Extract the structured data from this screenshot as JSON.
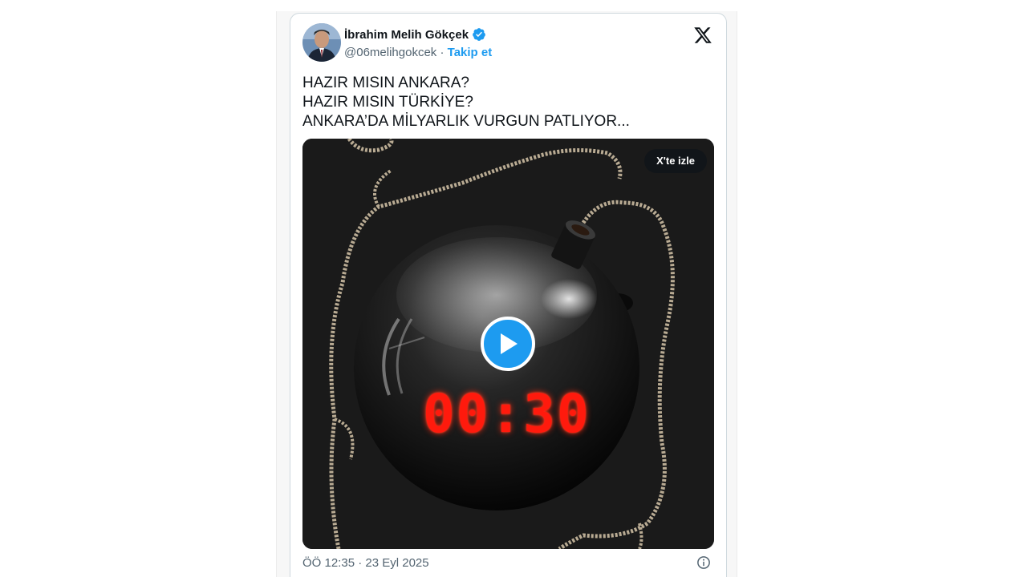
{
  "author": {
    "name": "İbrahim Melih Gökçek",
    "handle": "@06melihgokcek",
    "separator": " · ",
    "follow_label": "Takip et",
    "verified_color": "#1d9bf0"
  },
  "platform_logo": "x-logo-icon",
  "tweet": {
    "lines": [
      "HAZIR MISIN ANKARA?",
      "HAZIR MISIN TÜRKİYE?",
      "ANKARA’DA MİLYARLIK VURGUN PATLIYOR..."
    ]
  },
  "media": {
    "watch_label": "X'te izle",
    "timer": "00:30",
    "play_icon": "play-icon",
    "timer_color": "#ff1a0d"
  },
  "footer": {
    "timestamp": "ÖÖ 12:35 · 23 Eyl 2025",
    "info_icon": "info-icon"
  },
  "colors": {
    "accent": "#1d9bf0",
    "text": "#0f1419",
    "secondary_text": "#536471"
  }
}
